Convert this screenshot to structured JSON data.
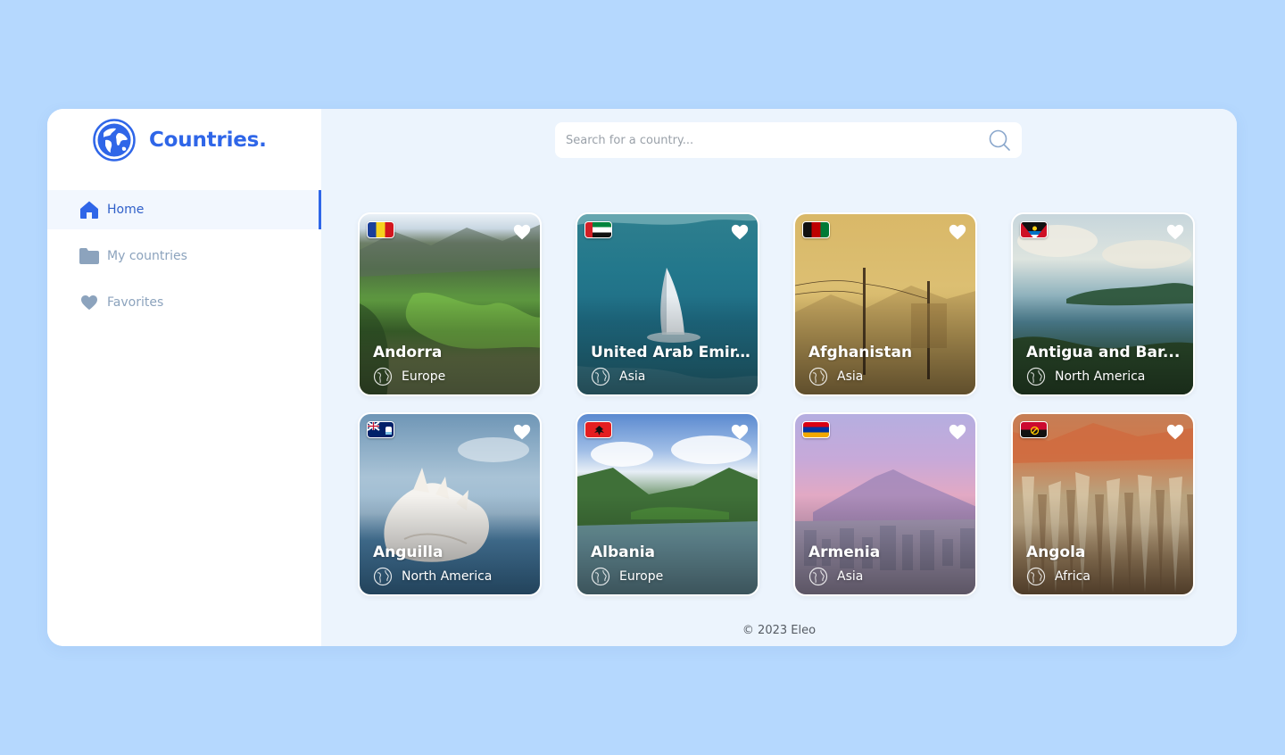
{
  "app": {
    "title": "Countries."
  },
  "sidebar": {
    "items": [
      {
        "label": "Home",
        "icon": "home-icon",
        "active": true
      },
      {
        "label": "My countries",
        "icon": "folder-icon",
        "active": false
      },
      {
        "label": "Favorites",
        "icon": "heart-icon",
        "active": false
      }
    ]
  },
  "search": {
    "placeholder": "Search for a country..."
  },
  "cards": [
    {
      "name": "Andorra",
      "region": "Europe",
      "flag": "andorra-flag-icon"
    },
    {
      "name": "United Arab Emir...",
      "region": "Asia",
      "flag": "uae-flag-icon"
    },
    {
      "name": "Afghanistan",
      "region": "Asia",
      "flag": "afghanistan-flag-icon"
    },
    {
      "name": "Antigua and Bar...",
      "region": "North America",
      "flag": "antigua-flag-icon"
    },
    {
      "name": "Anguilla",
      "region": "North America",
      "flag": "anguilla-flag-icon"
    },
    {
      "name": "Albania",
      "region": "Europe",
      "flag": "albania-flag-icon"
    },
    {
      "name": "Armenia",
      "region": "Asia",
      "flag": "armenia-flag-icon"
    },
    {
      "name": "Angola",
      "region": "Africa",
      "flag": "angola-flag-icon"
    }
  ],
  "footer": {
    "text": "© 2023 Eleo"
  },
  "colors": {
    "page_background": "#b5d8fe",
    "accent": "#2f66e8",
    "main_background": "#ecf4fd",
    "nav_inactive": "#8ca3bd"
  }
}
